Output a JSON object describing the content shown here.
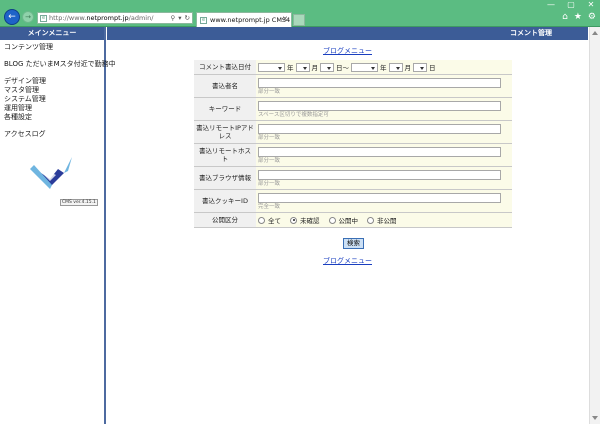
{
  "browser": {
    "url_prefix": "http://www.",
    "url_domain": "netprompt.jp",
    "url_path": "/admin/",
    "tab_label": "www.netprompt.jp  CMS4",
    "window_controls": [
      "—",
      "▢",
      "✕"
    ],
    "address_tools": [
      "⚲",
      "▾",
      "↻"
    ]
  },
  "sidebar": {
    "header": "メインメニュー",
    "group1": [
      "コンテンツ管理"
    ],
    "group2": [
      "BLOG ただいまMスタ付近で勤務中"
    ],
    "group3": [
      "デザイン管理",
      "マスタ管理",
      "システム管理",
      "運用管理",
      "各種設定"
    ],
    "group4": [
      "アクセスログ"
    ],
    "version": "CMS ver.4.15.1"
  },
  "main": {
    "header": "コメント管理",
    "blog_menu_link": "ブログメニュー",
    "search_button": "検索"
  },
  "form": {
    "date": {
      "label": "コメント書込日付",
      "year": "年",
      "month": "月",
      "day": "日",
      "range": "日～"
    },
    "author": {
      "label": "書込者名",
      "value": "",
      "hint": "部分一致"
    },
    "keyword": {
      "label": "キーワード",
      "value": "",
      "hint": "スペース区切りで複数指定可"
    },
    "ip": {
      "label": "書込リモートIPアドレス",
      "value": "",
      "hint": "部分一致"
    },
    "host": {
      "label": "書込リモートホスト",
      "value": "",
      "hint": "部分一致"
    },
    "ua": {
      "label": "書込ブラウザ情報",
      "value": "",
      "hint": "部分一致"
    },
    "cookie": {
      "label": "書込クッキーID",
      "value": "",
      "hint": "完全一致"
    },
    "status": {
      "label": "公開区分",
      "options": [
        "全て",
        "未確認",
        "公開中",
        "非公開"
      ],
      "selected": "未確認"
    }
  },
  "colors": {
    "chrome": "#5bbc82",
    "header": "#3c5c97",
    "link": "#1a3fc0",
    "field_bg": "#fbfbe8"
  }
}
